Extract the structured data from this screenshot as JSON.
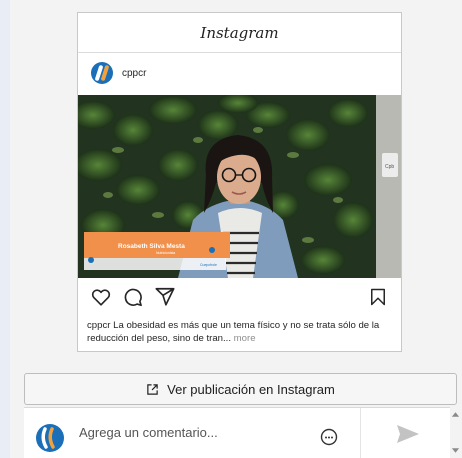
{
  "embed": {
    "brand": "Instagram",
    "account": "cppcr",
    "banner_name": "Rosabeth Silva Mesta",
    "banner_sub": "Nutricionista",
    "banner_logo": "Cuepcfrole",
    "wall_sign": "Cpb",
    "caption_user": "cppcr",
    "caption_text": " La obesidad es más que un tema físico y no se trata sólo de la reducción del peso, sino de tran...",
    "caption_more": " more"
  },
  "actions": {
    "like_icon": "heart-icon",
    "comment_icon": "comment-icon",
    "share_icon": "send-icon",
    "save_icon": "bookmark-icon"
  },
  "view_button": {
    "label": "Ver publicación en Instagram",
    "icon": "external-link-icon"
  },
  "comment_bar": {
    "placeholder": "Agrega un comentario...",
    "emoji_icon": "emoji-icon",
    "send_icon": "send-arrow-icon"
  },
  "colors": {
    "brand_blue": "#1b6fb8",
    "brand_orange": "#f2a23c",
    "banner_orange": "#f0904a"
  }
}
